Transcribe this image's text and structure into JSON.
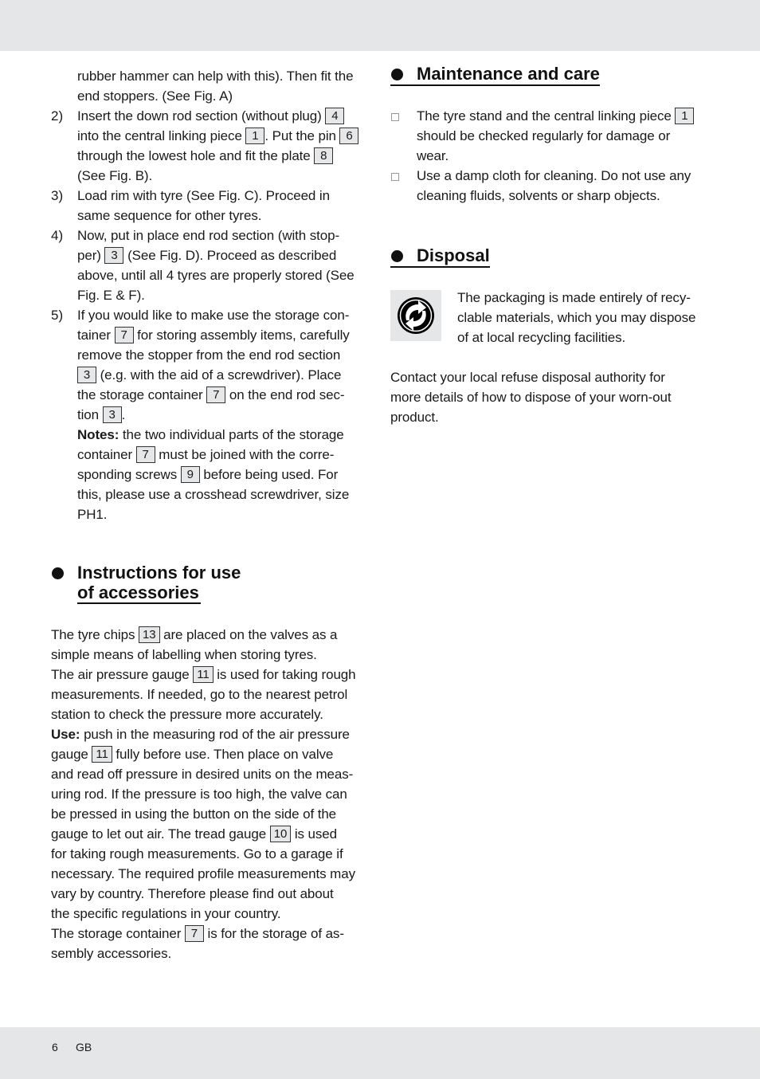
{
  "left_column": {
    "continuation": {
      "lines": [
        "rubber hammer can help with this). Then fit the",
        "end stoppers. (See Fig. A)"
      ]
    },
    "steps": [
      {
        "number": "2)",
        "segments": [
          {
            "t": "Insert the down rod section (without plug) "
          },
          {
            "ref": "4"
          },
          {
            "br": true
          },
          {
            "t": "into the central linking piece "
          },
          {
            "ref": "1"
          },
          {
            "t": ". Put the pin "
          },
          {
            "ref": "6"
          },
          {
            "br": true
          },
          {
            "t": "through the lowest hole and fit the plate "
          },
          {
            "ref": "8"
          },
          {
            "br": true
          },
          {
            "t": "(See Fig. B)."
          }
        ]
      },
      {
        "number": "3)",
        "segments": [
          {
            "t": "Load rim with tyre (See Fig. C). Proceed in"
          },
          {
            "br": true
          },
          {
            "t": "same sequence for other tyres."
          }
        ]
      },
      {
        "number": "4)",
        "segments": [
          {
            "t": "Now, put in place end rod section (with stop-"
          },
          {
            "br": true
          },
          {
            "t": "per) "
          },
          {
            "ref": "3"
          },
          {
            "t": " (See Fig. D). Proceed as described"
          },
          {
            "br": true
          },
          {
            "t": "above, until all 4 tyres are properly stored (See"
          },
          {
            "br": true
          },
          {
            "t": "Fig. E & F)."
          }
        ]
      },
      {
        "number": "5)",
        "segments": [
          {
            "t": "If you would like to make use the storage con-"
          },
          {
            "br": true
          },
          {
            "t": "tainer "
          },
          {
            "ref": "7"
          },
          {
            "t": " for storing assembly items, carefully"
          },
          {
            "br": true
          },
          {
            "t": "remove the stopper from the end rod section"
          },
          {
            "br": true
          },
          {
            "ref": "3"
          },
          {
            "t": " (e.g. with the aid of a screwdriver). Place"
          },
          {
            "br": true
          },
          {
            "t": "the storage container "
          },
          {
            "ref": "7"
          },
          {
            "t": " on the end rod sec-"
          },
          {
            "br": true
          },
          {
            "t": "tion "
          },
          {
            "ref": "3"
          },
          {
            "t": "."
          },
          {
            "br": true
          },
          {
            "b": "Notes:"
          },
          {
            "t": " the two individual parts of the storage"
          },
          {
            "br": true
          },
          {
            "t": "container "
          },
          {
            "ref": "7"
          },
          {
            "t": " must be joined with the corre-"
          },
          {
            "br": true
          },
          {
            "t": "sponding screws "
          },
          {
            "ref": "9"
          },
          {
            "t": " before being used. For"
          },
          {
            "br": true
          },
          {
            "t": "this, please use a crosshead screwdriver, size"
          },
          {
            "br": true
          },
          {
            "t": "PH1."
          }
        ]
      }
    ],
    "accessories": {
      "heading_line1": "Instructions for use",
      "heading_line2": "of accessories",
      "segments": [
        {
          "t": "The tyre chips "
        },
        {
          "ref": "13"
        },
        {
          "t": " are placed on the valves as a"
        },
        {
          "br": true
        },
        {
          "t": "simple means of labelling when storing tyres."
        },
        {
          "br": true
        },
        {
          "t": "The air pressure gauge "
        },
        {
          "ref": "11"
        },
        {
          "t": " is used for taking rough"
        },
        {
          "br": true
        },
        {
          "t": "measurements. If needed, go to the nearest petrol"
        },
        {
          "br": true
        },
        {
          "t": "station to check the pressure more accurately."
        },
        {
          "br": true
        },
        {
          "b": "Use:"
        },
        {
          "t": " push in the measuring rod of the air pressure"
        },
        {
          "br": true
        },
        {
          "t": "gauge "
        },
        {
          "ref": "11"
        },
        {
          "t": " fully before use. Then place on valve"
        },
        {
          "br": true
        },
        {
          "t": "and read off pressure in desired units on the meas-"
        },
        {
          "br": true
        },
        {
          "t": "uring rod. If the pressure is too high, the valve can"
        },
        {
          "br": true
        },
        {
          "t": "be pressed in using the button on the side of the"
        },
        {
          "br": true
        },
        {
          "t": "gauge to let out air. The tread gauge "
        },
        {
          "ref": "10"
        },
        {
          "t": " is used"
        },
        {
          "br": true
        },
        {
          "t": "for taking rough measurements. Go to a garage if"
        },
        {
          "br": true
        },
        {
          "t": "necessary. The required profile measurements may"
        },
        {
          "br": true
        },
        {
          "t": "vary by country. Therefore please find out about"
        },
        {
          "br": true
        },
        {
          "t": "the specific regulations in your country."
        },
        {
          "br": true
        },
        {
          "t": "The storage container "
        },
        {
          "ref": "7"
        },
        {
          "t": " is for the storage of as-"
        },
        {
          "br": true
        },
        {
          "t": "sembly accessories."
        }
      ]
    }
  },
  "right_column": {
    "maintenance": {
      "heading": "Maintenance and care",
      "items": [
        {
          "segments": [
            {
              "t": "The tyre stand and the central linking piece "
            },
            {
              "ref": "1"
            },
            {
              "br": true
            },
            {
              "t": "should be checked regularly for damage or"
            },
            {
              "br": true
            },
            {
              "t": "wear."
            }
          ]
        },
        {
          "segments": [
            {
              "t": "Use a damp cloth for cleaning. Do not use any"
            },
            {
              "br": true
            },
            {
              "t": "cleaning fluids, solvents or sharp objects."
            }
          ]
        }
      ]
    },
    "disposal": {
      "heading": "Disposal",
      "icon": "green-dot-recycling-icon",
      "packaging_lines": [
        "The packaging is made entirely of recy-",
        "clable materials, which you may dispose",
        "of at local recycling facilities."
      ],
      "contact_lines": [
        "Contact your local refuse disposal authority for",
        "more details of how to dispose of your worn-out",
        "product."
      ]
    }
  },
  "footer": {
    "page_number": "6",
    "language": "GB"
  }
}
